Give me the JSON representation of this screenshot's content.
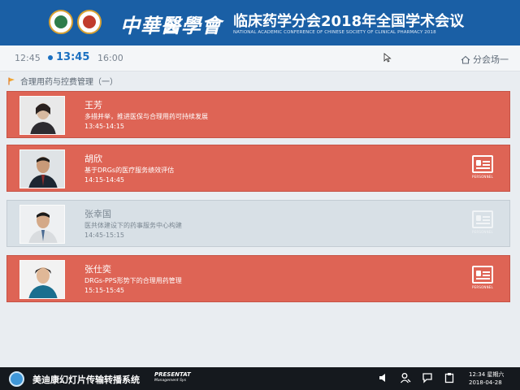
{
  "header": {
    "brand": "中華醫學會",
    "title": "临床药学分会2018年全国学术会议",
    "subtitle": "NATIONAL ACADEMIC CONFERENCE OF CHINESE SOCIETY OF CLINICAL PHARMACY 2018"
  },
  "timebar": {
    "times": [
      "12:45",
      "13:45",
      "16:00"
    ],
    "active_time": "13:45",
    "venue": "分会场一"
  },
  "section": {
    "title": "合理用药与控费管理（一）"
  },
  "sessions": [
    {
      "name": "王芳",
      "topic": "多措并举，推进医保与合理用药可持续发展",
      "time": "13:45-14:15",
      "state": "active",
      "has_pcard": false
    },
    {
      "name": "胡欣",
      "topic": "基于DRGs的医疗服务绩效评估",
      "time": "14:15-14:45",
      "state": "active",
      "has_pcard": true,
      "pcard_label": "PERSONNEL"
    },
    {
      "name": "张幸国",
      "topic": "医共体建设下的药事服务中心构建",
      "time": "14:45-15:15",
      "state": "inactive",
      "has_pcard": true,
      "pcard_label": "PERSONNEL"
    },
    {
      "name": "张仕奕",
      "topic": "DRGs-PPS形势下的合理用药管理",
      "time": "15:15-15:45",
      "state": "active",
      "has_pcard": true,
      "pcard_label": "PERSONNEL"
    }
  ],
  "taskbar": {
    "app_title": "美迪康幻灯片传输转播系统",
    "brand_line1": "PRESENTAT",
    "brand_line2": "Management Sys",
    "clock_time": "12:34 星期六",
    "clock_date": "2018-04-28"
  },
  "colors": {
    "header_bg": "#1a5fa5",
    "card_active": "#de6455",
    "card_inactive": "#d8e0e6",
    "time_active": "#1a6fc0",
    "taskbar_bg": "#15191e"
  },
  "icons": [
    "home-icon",
    "flag-icon",
    "cursor-icon",
    "personnel-card-icon",
    "speaker-photo",
    "volume-icon",
    "user-icon",
    "chat-icon",
    "clipboard-icon"
  ]
}
